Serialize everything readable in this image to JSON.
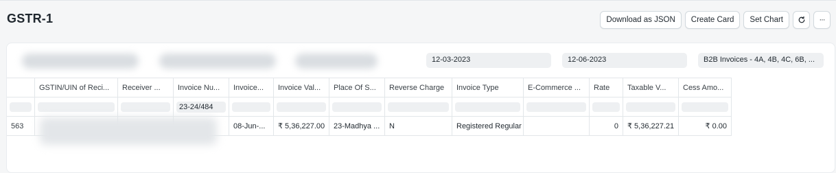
{
  "page": {
    "title": "GSTR-1"
  },
  "toolbar": {
    "download_json": "Download as JSON",
    "create_card": "Create Card",
    "set_chart": "Set Chart",
    "refresh_icon": "refresh-icon",
    "more_icon": "more-icon",
    "more_label": "···",
    "refresh_label": "↻"
  },
  "filters": {
    "from_date": "12-03-2023",
    "to_date": "12-06-2023",
    "report_type": "B2B Invoices - 4A, 4B, 4C, 6B, ..."
  },
  "table": {
    "columns": [
      "GSTIN/UIN of Reci...",
      "Receiver ...",
      "Invoice Nu...",
      "Invoice...",
      "Invoice Val...",
      "Place Of S...",
      "Reverse Charge",
      "Invoice Type",
      "E-Commerce ...",
      "Rate",
      "Taxable V...",
      "Cess Amo..."
    ],
    "filter_values": {
      "invoice_number": "23-24/484"
    },
    "rows": [
      {
        "row_number": "563",
        "gstin": "",
        "receiver": "",
        "invoice_number": "",
        "invoice_date": "08-Jun-...",
        "invoice_value": "₹ 5,36,227.00",
        "place_of_supply": "23-Madhya ...",
        "reverse_charge": "N",
        "invoice_type": "Registered Regular",
        "ecommerce": "",
        "rate": "0",
        "taxable_value": "₹ 5,36,227.21",
        "cess_amount": "₹ 0.00"
      }
    ]
  }
}
